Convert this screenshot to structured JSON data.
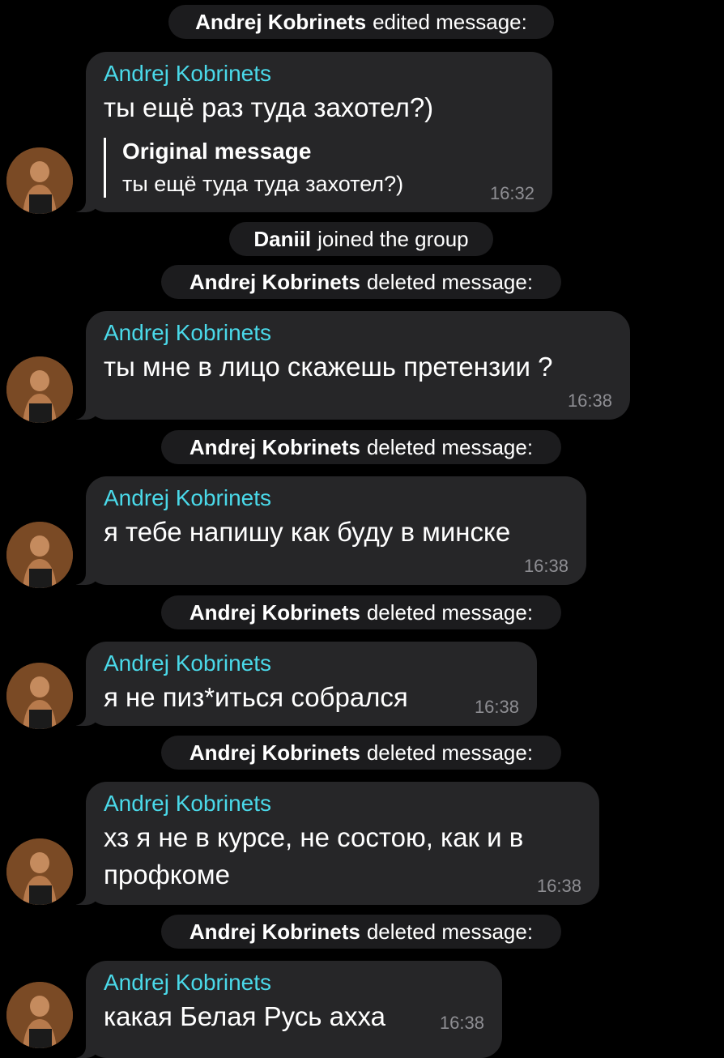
{
  "events": {
    "e1": {
      "name": "Andrej Kobrinets",
      "action": "edited message:"
    },
    "e2": {
      "name": "Daniil",
      "action": "joined the group"
    },
    "e3": {
      "name": "Andrej Kobrinets",
      "action": "deleted message:"
    },
    "e4": {
      "name": "Andrej Kobrinets",
      "action": "deleted message:"
    },
    "e5": {
      "name": "Andrej Kobrinets",
      "action": "deleted message:"
    },
    "e6": {
      "name": "Andrej Kobrinets",
      "action": "deleted message:"
    },
    "e7": {
      "name": "Andrej Kobrinets",
      "action": "deleted message:"
    }
  },
  "messages": {
    "m1": {
      "sender": "Andrej Kobrinets",
      "text": "ты ещё раз туда захотел?)",
      "quote_title": "Original message",
      "quote_text": "ты ещё туда туда захотел?)",
      "time": "16:32"
    },
    "m2": {
      "sender": "Andrej Kobrinets",
      "text": "ты мне в лицо скажешь претензии ?",
      "time": "16:38"
    },
    "m3": {
      "sender": "Andrej Kobrinets",
      "text": "я тебе напишу как буду в минске",
      "time": "16:38"
    },
    "m4": {
      "sender": "Andrej Kobrinets",
      "text": "я не пиз*иться собрался",
      "time": "16:38"
    },
    "m5": {
      "sender": "Andrej Kobrinets",
      "text_line1": "хз я не в курсе, не состою, как и в",
      "text_line2": "профкоме",
      "time": "16:38"
    },
    "m6": {
      "sender": "Andrej Kobrinets",
      "text": "какая Белая Русь ахха",
      "time": "16:38"
    }
  },
  "colors": {
    "background": "#000000",
    "bubble": "#262628",
    "service_pill": "#1c1c1e",
    "sender_name": "#4ad9e9",
    "timestamp": "#8e8e93"
  },
  "icons": {
    "avatar": "user-avatar-photo"
  }
}
